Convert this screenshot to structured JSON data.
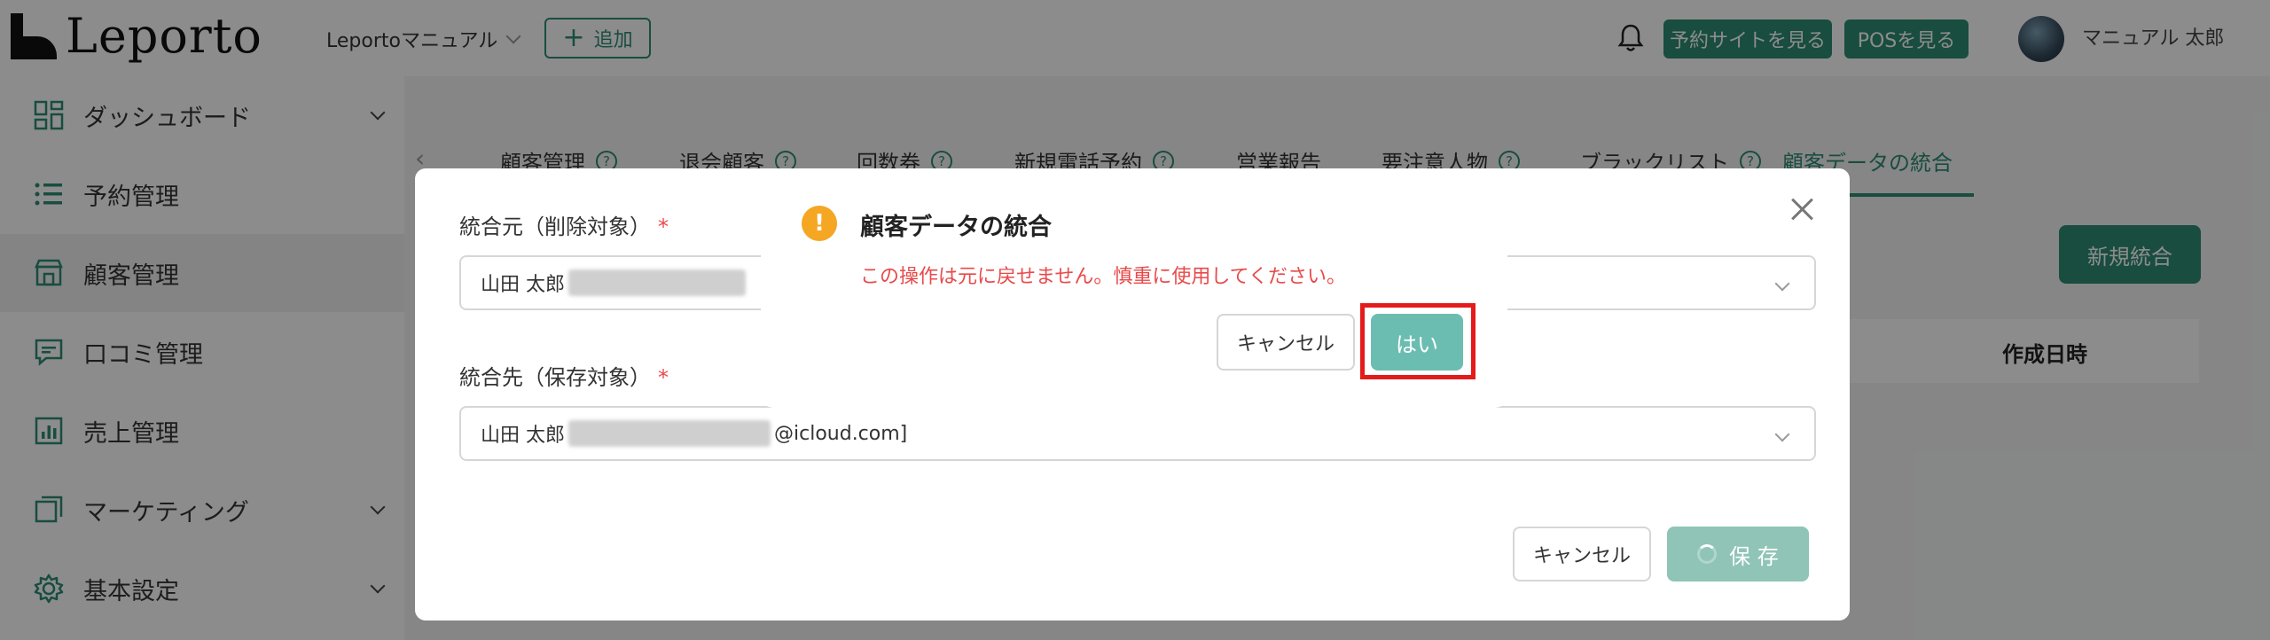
{
  "header": {
    "logo_text": "Leporto",
    "store_name": "Leportoマニュアル",
    "add_label": "追加",
    "view_site_label": "予約サイトを見る",
    "view_pos_label": "POSを見る",
    "user_name": "マニュアル 太郎",
    "icons": {
      "notification": "bell-icon",
      "add": "plus-icon",
      "store_dropdown": "chevron-down-icon"
    }
  },
  "sidebar": {
    "items": [
      {
        "label": "ダッシュボード",
        "icon": "dashboard-icon",
        "expandable": true
      },
      {
        "label": "予約管理",
        "icon": "list-icon",
        "expandable": false
      },
      {
        "label": "顧客管理",
        "icon": "store-icon",
        "expandable": false,
        "active": true
      },
      {
        "label": "口コミ管理",
        "icon": "comment-icon",
        "expandable": false
      },
      {
        "label": "売上管理",
        "icon": "chart-icon",
        "expandable": false
      },
      {
        "label": "マーケティング",
        "icon": "marketing-icon",
        "expandable": true
      },
      {
        "label": "基本設定",
        "icon": "gear-icon",
        "expandable": true
      }
    ]
  },
  "tabs": [
    {
      "label": "顧客管理",
      "help": true
    },
    {
      "label": "退会顧客",
      "help": true
    },
    {
      "label": "回数券",
      "help": true
    },
    {
      "label": "新規電話予約",
      "help": true
    },
    {
      "label": "営業報告",
      "help": false
    },
    {
      "label": "要注意人物",
      "help": true
    },
    {
      "label": "ブラックリスト",
      "help": true
    },
    {
      "label": "顧客データの統合",
      "help": false,
      "active": true
    }
  ],
  "page": {
    "new_merge_label": "新規統合",
    "column_created": "作成日時"
  },
  "merge_modal": {
    "source_label": "統合元（削除対象）",
    "source_value_name": "山田 太郎",
    "target_label": "統合先（保存対象）",
    "target_value_name": "山田 太郎",
    "target_value_suffix": "@icloud.com]",
    "required_mark": "*",
    "cancel_label": "キャンセル",
    "save_label": "保 存"
  },
  "confirm_dialog": {
    "title": "顧客データの統合",
    "message": "この操作は元に戻せません。慎重に使用してください。",
    "cancel_label": "キャンセル",
    "ok_label": "はい",
    "icon": "warning-icon",
    "icon_glyph": "!"
  },
  "colors": {
    "brand": "#2d8c74",
    "danger": "#e84a4a",
    "warning": "#f5a623",
    "highlight": "#e41b1b"
  }
}
